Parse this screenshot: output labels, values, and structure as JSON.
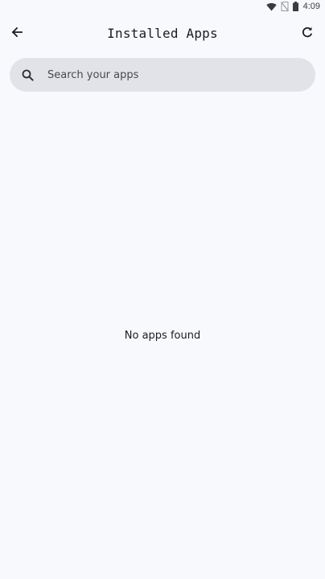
{
  "status_bar": {
    "time": "4:09",
    "icons": [
      "wifi-icon",
      "no-sim-icon",
      "battery-icon"
    ]
  },
  "top_bar": {
    "title": "Installed Apps",
    "back_icon": "arrow-back-icon",
    "refresh_icon": "refresh-icon"
  },
  "search": {
    "icon": "search-icon",
    "placeholder": "Search your apps",
    "value": ""
  },
  "main": {
    "empty_message": "No apps found"
  },
  "colors": {
    "background": "#f8f9fd",
    "search_background": "#e2e3e8",
    "text": "#1c1c1f"
  }
}
